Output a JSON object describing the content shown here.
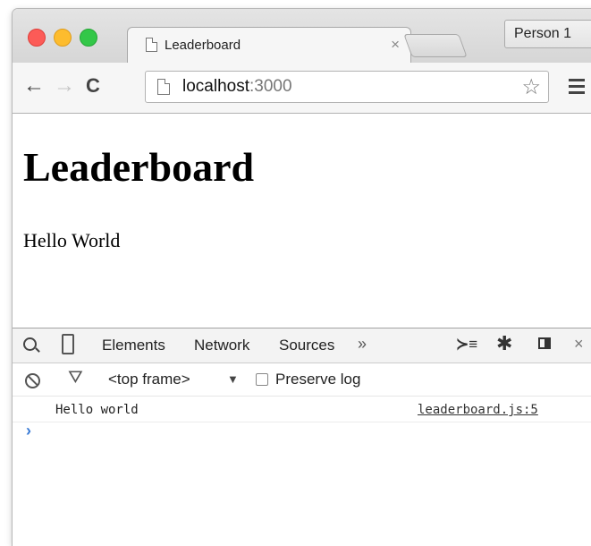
{
  "tab": {
    "title": "Leaderboard",
    "close_glyph": "×"
  },
  "profile": {
    "label": "Person 1"
  },
  "toolbar": {
    "back_glyph": "←",
    "forward_glyph": "→",
    "reload_glyph": "C",
    "url_host": "localhost",
    "url_port": ":3000",
    "star_glyph": "☆"
  },
  "page": {
    "heading": "Leaderboard",
    "body": "Hello World"
  },
  "devtools": {
    "tabs": [
      "Elements",
      "Network",
      "Sources"
    ],
    "more_glyph": "»",
    "drawer_glyph": "≻≡",
    "gear_glyph": "✱",
    "close_glyph": "×",
    "filter_glyph": "⛛",
    "frame_label": "<top frame>",
    "frame_arrow": "▼",
    "preserve_log_label": "Preserve log",
    "preserve_log_checked": false,
    "console": [
      {
        "message": "Hello world",
        "source": "leaderboard.js:5"
      }
    ],
    "prompt_glyph": "›"
  },
  "colors": {
    "close": "#fc5b57",
    "minimize": "#fdbc2e",
    "zoom": "#33c748",
    "prompt": "#3a7bd5"
  },
  "icons": [
    "search-icon",
    "device-mode-icon",
    "drawer-icon",
    "gear-icon",
    "dock-icon",
    "clear-icon",
    "filter-icon",
    "star-icon",
    "menu-icon",
    "page-icon"
  ]
}
